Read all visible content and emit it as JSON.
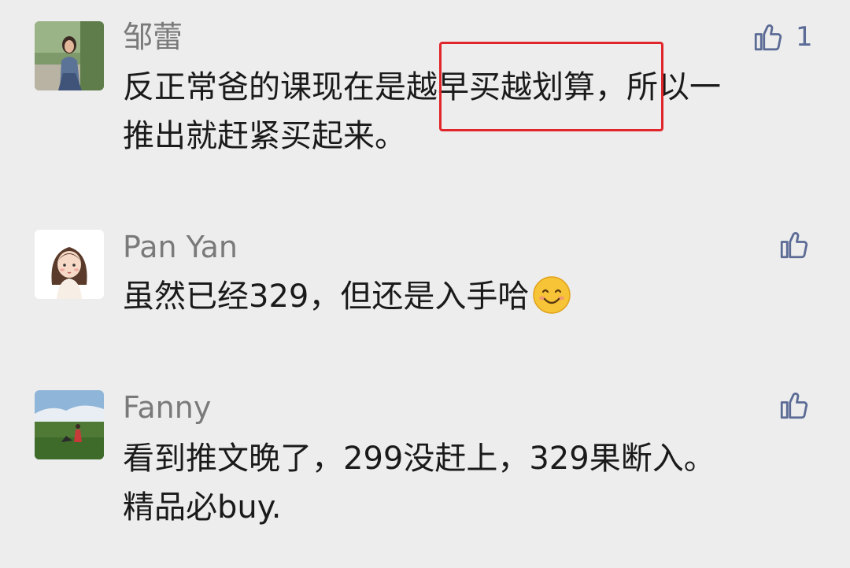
{
  "comments": [
    {
      "name": "邹蕾",
      "likes": "1",
      "avatar_icon": "woman-portrait-avatar",
      "lines": [
        "反正常爸的课现在是越早买越划算，所以一",
        "推出就赶紧买起来。"
      ],
      "highlight_color": "#e0262a"
    },
    {
      "name": "Pan Yan",
      "likes": "",
      "avatar_icon": "cartoon-girl-avatar",
      "lines": [
        "虽然已经329，但还是入手哈"
      ],
      "emoji": "smiling-face-emoji"
    },
    {
      "name": "Fanny",
      "likes": "",
      "avatar_icon": "landscape-photo-avatar",
      "lines": [
        "看到推文晚了，299没赶上，329果断入。",
        "精品必buy."
      ]
    }
  ],
  "colors": {
    "background": "#ededed",
    "name_text": "#7a7a7a",
    "body_text": "#1a1a1a",
    "like_icon": "#5b6b95"
  }
}
